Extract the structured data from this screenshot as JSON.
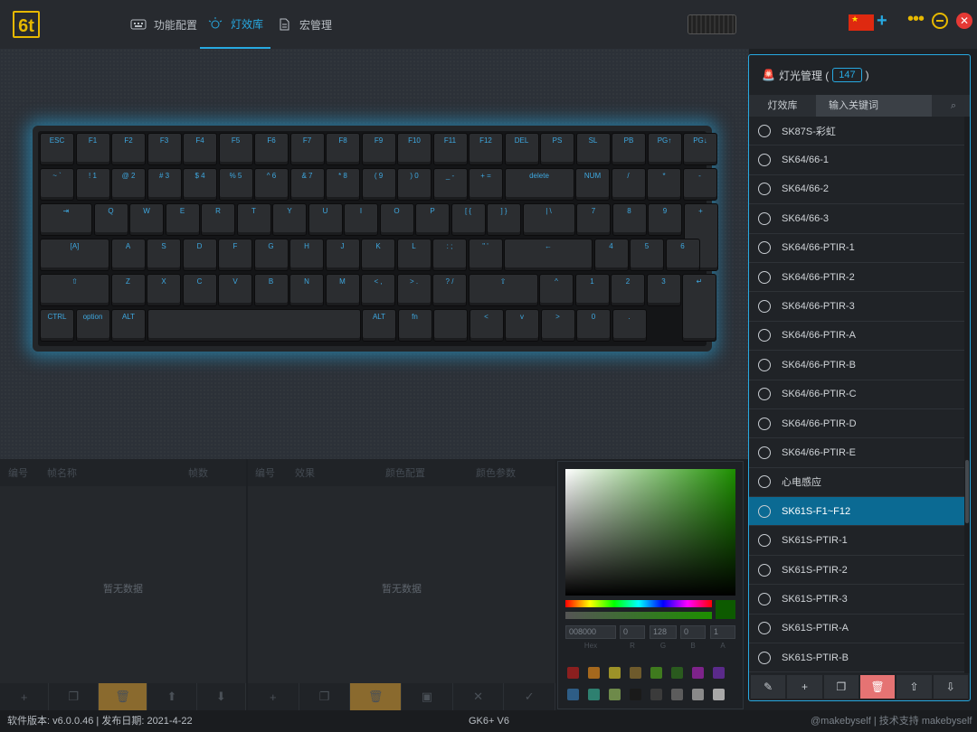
{
  "app": {
    "logo": "6t"
  },
  "nav": [
    {
      "label": "功能配置",
      "icon": "keyboard-icon"
    },
    {
      "label": "灯效库",
      "icon": "light-icon",
      "active": true
    },
    {
      "label": "宏管理",
      "icon": "document-icon"
    }
  ],
  "top": {
    "flag": "china-flag"
  },
  "frames": {
    "col_no": "编号",
    "col_name": "帧名称",
    "col_count": "帧数",
    "empty": "暂无数据"
  },
  "effects": {
    "col_no": "编号",
    "col_effect": "效果",
    "col_color": "颜色配置",
    "col_param": "颜色参数",
    "empty": "暂无数据"
  },
  "picker": {
    "hex": "008000",
    "r": "0",
    "g": "128",
    "b": "0",
    "a": "1",
    "lbl_hex": "Hex",
    "lbl_r": "R",
    "lbl_g": "G",
    "lbl_b": "B",
    "lbl_a": "A",
    "swatches": [
      "#8b1f1f",
      "#a5681d",
      "#9d9228",
      "#6e5a2c",
      "#3f7a1e",
      "#2a5a1e",
      "#7d238a",
      "#5a2a8a",
      "#2e5d86",
      "#2e8070",
      "#6e8a4a",
      "#1a1a1a",
      "#3b3b3b",
      "#5c5c5c",
      "#8a8a8a",
      "#a8a8a8"
    ]
  },
  "lights": {
    "title": "灯光管理 (",
    "count": "147",
    "close": ")",
    "tab": "灯效库",
    "search_placeholder": "输入关键词",
    "items": [
      "SK87S-彩虹",
      "SK64/66-1",
      "SK64/66-2",
      "SK64/66-3",
      "SK64/66-PTIR-1",
      "SK64/66-PTIR-2",
      "SK64/66-PTIR-3",
      "SK64/66-PTIR-A",
      "SK64/66-PTIR-B",
      "SK64/66-PTIR-C",
      "SK64/66-PTIR-D",
      "SK64/66-PTIR-E",
      "心电感应",
      "SK61S-F1~F12",
      "SK61S-PTIR-1",
      "SK61S-PTIR-2",
      "SK61S-PTIR-3",
      "SK61S-PTIR-A",
      "SK61S-PTIR-B"
    ],
    "selected": 13
  },
  "status": {
    "left": "软件版本: v6.0.0.46 | 发布日期: 2021-4-22",
    "center": "GK6+ V6",
    "right": "@makebyself | 技术支持 makebyself"
  },
  "keys": [
    [
      "ESC",
      "F1",
      "F2",
      "F3",
      "F4",
      "F5",
      "F6",
      "F7",
      "F8",
      "F9",
      "F10",
      "F11",
      "F12",
      "DEL",
      "PS",
      "SL",
      "PB",
      "PG↑",
      "PG↓"
    ],
    [
      "~ `",
      "! 1",
      "@ 2",
      "# 3",
      "$ 4",
      "% 5",
      "^ 6",
      "& 7",
      "* 8",
      "( 9",
      ") 0",
      "_ -",
      "+ =",
      "delete",
      "NUM",
      "/",
      "*",
      "-"
    ],
    [
      "⇥",
      "Q",
      "W",
      "E",
      "R",
      "T",
      "Y",
      "U",
      "I",
      "O",
      "P",
      "[ {",
      "] }",
      "| \\",
      "7",
      "8",
      "9",
      "+"
    ],
    [
      "[A]",
      "A",
      "S",
      "D",
      "F",
      "G",
      "H",
      "J",
      "K",
      "L",
      ": ;",
      "\" '",
      "←",
      "4",
      "5",
      "6"
    ],
    [
      "⇧",
      "Z",
      "X",
      "C",
      "V",
      "B",
      "N",
      "M",
      "< ,",
      "> .",
      "? /",
      "⇧",
      "^",
      "1",
      "2",
      "3",
      "↵"
    ],
    [
      "CTRL",
      "option",
      "ALT",
      "",
      "ALT",
      "fn",
      "",
      "<",
      "v",
      ">",
      "0",
      "."
    ]
  ]
}
